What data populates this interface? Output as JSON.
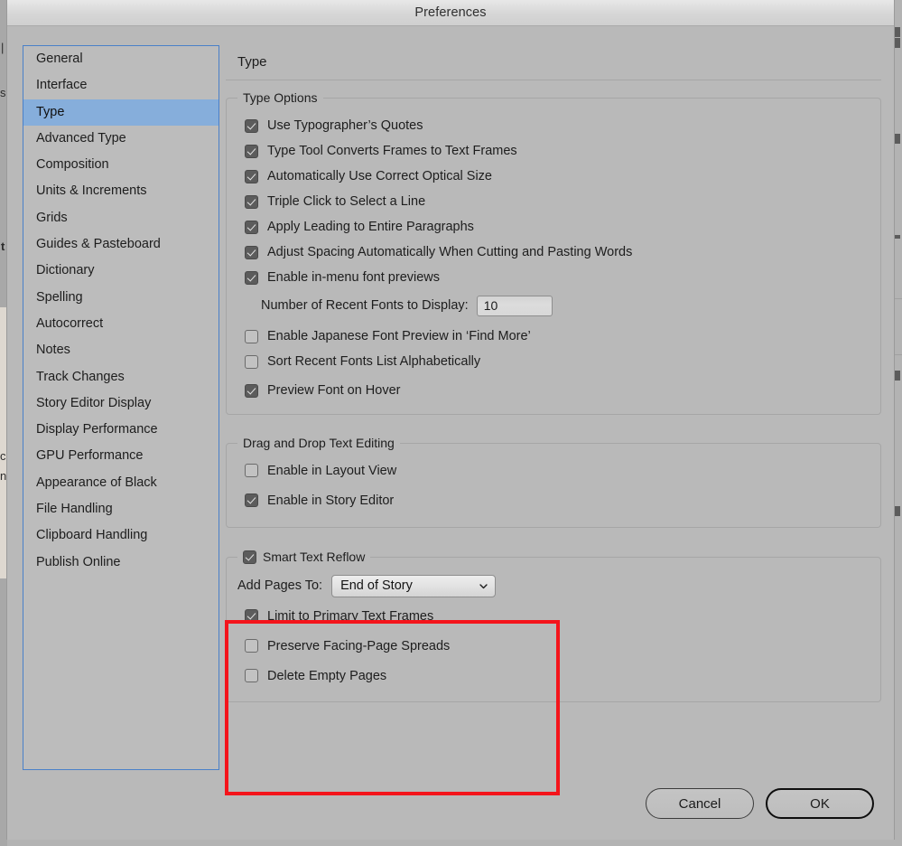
{
  "window": {
    "title": "Preferences"
  },
  "sidebar": {
    "items": [
      {
        "label": "General",
        "selected": false
      },
      {
        "label": "Interface",
        "selected": false
      },
      {
        "label": "Type",
        "selected": true
      },
      {
        "label": "Advanced Type",
        "selected": false
      },
      {
        "label": "Composition",
        "selected": false
      },
      {
        "label": "Units & Increments",
        "selected": false
      },
      {
        "label": "Grids",
        "selected": false
      },
      {
        "label": "Guides & Pasteboard",
        "selected": false
      },
      {
        "label": "Dictionary",
        "selected": false
      },
      {
        "label": "Spelling",
        "selected": false
      },
      {
        "label": "Autocorrect",
        "selected": false
      },
      {
        "label": "Notes",
        "selected": false
      },
      {
        "label": "Track Changes",
        "selected": false
      },
      {
        "label": "Story Editor Display",
        "selected": false
      },
      {
        "label": "Display Performance",
        "selected": false
      },
      {
        "label": "GPU Performance",
        "selected": false
      },
      {
        "label": "Appearance of Black",
        "selected": false
      },
      {
        "label": "File Handling",
        "selected": false
      },
      {
        "label": "Clipboard Handling",
        "selected": false
      },
      {
        "label": "Publish Online",
        "selected": false
      }
    ]
  },
  "pane": {
    "title": "Type",
    "type_options": {
      "legend": "Type Options",
      "items": [
        {
          "label": "Use Typographer’s Quotes",
          "checked": true
        },
        {
          "label": "Type Tool Converts Frames to Text Frames",
          "checked": true
        },
        {
          "label": "Automatically Use Correct Optical Size",
          "checked": true
        },
        {
          "label": "Triple Click to Select a Line",
          "checked": true
        },
        {
          "label": "Apply Leading to Entire Paragraphs",
          "checked": true
        },
        {
          "label": "Adjust Spacing Automatically When Cutting and Pasting Words",
          "checked": true
        },
        {
          "label": "Enable in-menu font previews",
          "checked": true
        }
      ],
      "recent_fonts": {
        "label": "Number of Recent Fonts to Display:",
        "value": "10"
      },
      "items_after": [
        {
          "label": "Enable Japanese Font Preview in ‘Find More’",
          "checked": false
        },
        {
          "label": "Sort Recent Fonts List Alphabetically",
          "checked": false
        },
        {
          "label": "Preview Font on Hover",
          "checked": true
        }
      ]
    },
    "drag_drop": {
      "legend": "Drag and Drop Text Editing",
      "items": [
        {
          "label": "Enable in Layout View",
          "checked": false
        },
        {
          "label": "Enable in Story Editor",
          "checked": true
        }
      ]
    },
    "smart_text_reflow": {
      "legend": "Smart Text Reflow",
      "legend_checked": true,
      "add_pages": {
        "label": "Add Pages To:",
        "value": "End of Story"
      },
      "items": [
        {
          "label": "Limit to Primary Text Frames",
          "checked": true
        },
        {
          "label": "Preserve Facing-Page Spreads",
          "checked": false
        },
        {
          "label": "Delete Empty Pages",
          "checked": false
        }
      ]
    }
  },
  "footer": {
    "cancel_label": "Cancel",
    "ok_label": "OK"
  },
  "annotation": {
    "highlight_color": "#f4141b"
  },
  "background": {
    "fragments": [
      "t",
      "s",
      "c",
      "nl",
      "|"
    ]
  }
}
